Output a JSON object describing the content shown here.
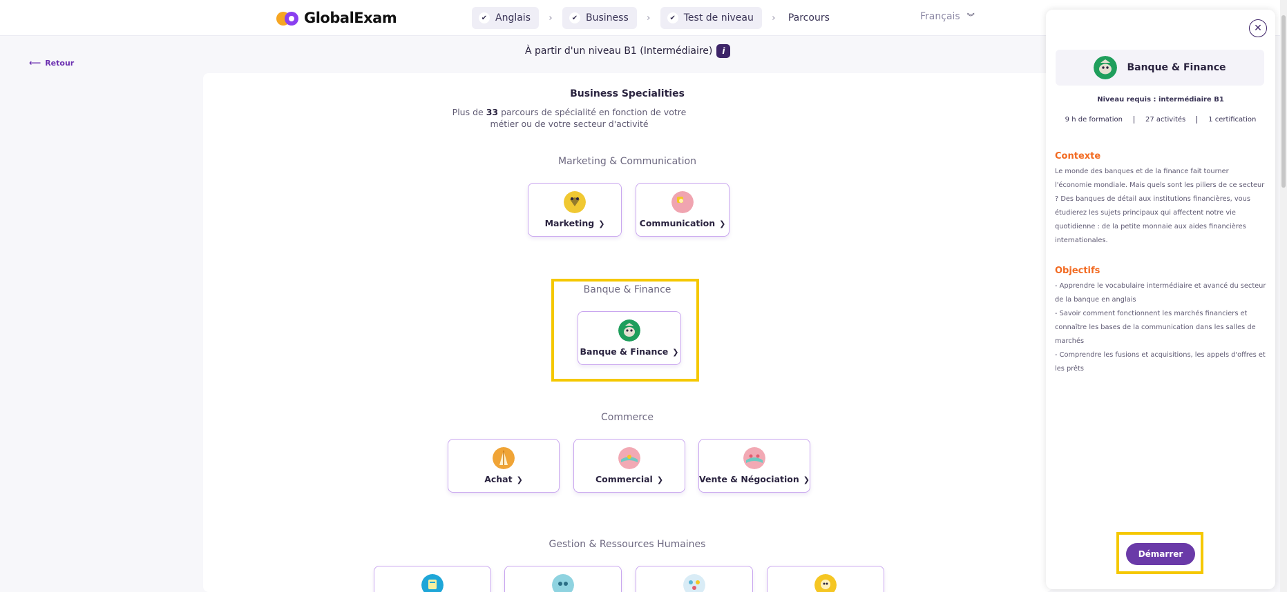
{
  "header": {
    "logo_text": "GlobalExam",
    "crumbs": [
      "Anglais",
      "Business",
      "Test de niveau"
    ],
    "crumb_last": "Parcours",
    "language": "Français"
  },
  "back_label": "Retour",
  "level_label": "À partir d'un niveau B1 (Intermédiaire)",
  "info_label": "i",
  "panel": {
    "title": "Business Specialities",
    "subtitle_pre": "Plus de ",
    "subtitle_count": "33",
    "subtitle_post": " parcours de spécialité en fonction de votre métier ou de votre secteur d'activité",
    "sections": [
      {
        "label": "Marketing & Communication",
        "cards": [
          "Marketing",
          "Communication"
        ]
      },
      {
        "label": "Banque & Finance",
        "cards": [
          "Banque & Finance"
        ]
      },
      {
        "label": "Commerce",
        "cards": [
          "Achat",
          "Commercial",
          "Vente & Négociation"
        ]
      },
      {
        "label": "Gestion & Ressources Humaines",
        "cards": []
      }
    ]
  },
  "drawer": {
    "title": "Banque & Finance",
    "requirement": "Niveau requis : intermédiaire B1",
    "stats": [
      "9 h de formation",
      "27 activités",
      "1 certification"
    ],
    "context_title": "Contexte",
    "context_text": "Le monde des banques et de la finance fait tourner l'économie mondiale. Mais quels sont les piliers de ce secteur ? Des banques de détail aux institutions financières, vous étudierez les sujets principaux qui affectent notre vie quotidienne : de la petite monnaie aux aides financières internationales.",
    "objectives_title": "Objectifs",
    "objectives": [
      "- Apprendre le vocabulaire intermédiaire et avancé du secteur de la banque en anglais",
      "- Savoir comment fonctionnent les marchés financiers et connaître les bases de la communication dans les salles de marchés",
      "- Comprendre les fusions et acquisitions, les appels d'offres et les prêts"
    ],
    "start_button": "Démarrer"
  },
  "colors": {
    "accent": "#6a3aa8",
    "orange": "#f26a21",
    "highlight": "#f5c800",
    "card_border": "#c9a6ef"
  }
}
